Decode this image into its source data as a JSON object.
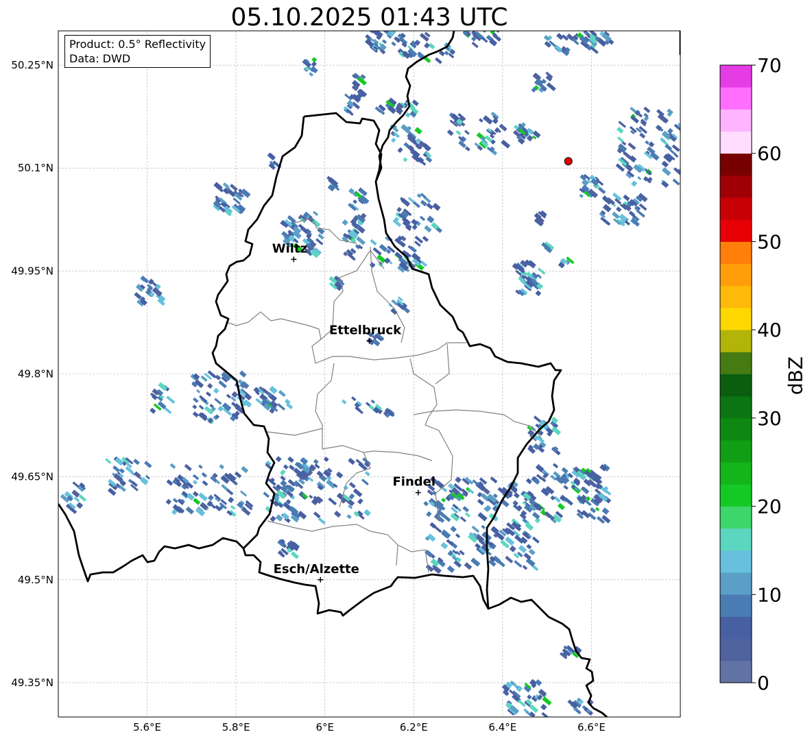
{
  "title": "05.10.2025 01:43 UTC",
  "info_box": {
    "product": "Product: 0.5° Reflectivity",
    "source": "Data: DWD"
  },
  "map": {
    "lon_range": [
      5.4,
      6.8
    ],
    "lat_range": [
      49.3,
      50.3
    ],
    "x_ticks": [
      {
        "value": 5.6,
        "label": "5.6°E"
      },
      {
        "value": 5.8,
        "label": "5.8°E"
      },
      {
        "value": 6.0,
        "label": "6°E"
      },
      {
        "value": 6.2,
        "label": "6.2°E"
      },
      {
        "value": 6.4,
        "label": "6.4°E"
      },
      {
        "value": 6.6,
        "label": "6.6°E"
      }
    ],
    "y_ticks": [
      {
        "value": 50.25,
        "label": "50.25°N"
      },
      {
        "value": 50.1,
        "label": "50.1°N"
      },
      {
        "value": 49.95,
        "label": "49.95°N"
      },
      {
        "value": 49.8,
        "label": "49.8°N"
      },
      {
        "value": 49.65,
        "label": "49.65°N"
      },
      {
        "value": 49.5,
        "label": "49.5°N"
      },
      {
        "value": 49.35,
        "label": "49.35°N"
      }
    ],
    "grid": true,
    "cities": [
      {
        "name": "Wiltz",
        "lon": 5.93,
        "lat": 49.967
      },
      {
        "name": "Ettelbruck",
        "lon": 6.1,
        "lat": 49.848
      },
      {
        "name": "Findel",
        "lon": 6.21,
        "lat": 49.627
      },
      {
        "name": "Esch/Alzette",
        "lon": 5.99,
        "lat": 49.5
      }
    ],
    "radar_site": {
      "lon": 6.548,
      "lat": 50.11,
      "color": "#e60000"
    },
    "colors": {
      "border": "#000000",
      "cantons": "#808080",
      "grid": "#b0b0b0"
    }
  },
  "colorbar": {
    "label": "dBZ",
    "min": 0,
    "max": 70,
    "step": 2.5,
    "tick_labels": [
      "0",
      "10",
      "20",
      "30",
      "40",
      "50",
      "60",
      "70"
    ],
    "colors": [
      "#6272a4",
      "#5062a0",
      "#4660a2",
      "#4a7bb3",
      "#5b9ec6",
      "#67c1dc",
      "#5dd6c0",
      "#3dd66a",
      "#15c925",
      "#13b51a",
      "#119e14",
      "#0e8812",
      "#0b7512",
      "#0a5e0e",
      "#457b12",
      "#b2b507",
      "#ffd700",
      "#ffb90a",
      "#ff9e0a",
      "#ff7f0a",
      "#e60005",
      "#c80005",
      "#a00005",
      "#780000",
      "#ffddff",
      "#ffb4ff",
      "#ff6eff",
      "#e63ce6"
    ]
  }
}
